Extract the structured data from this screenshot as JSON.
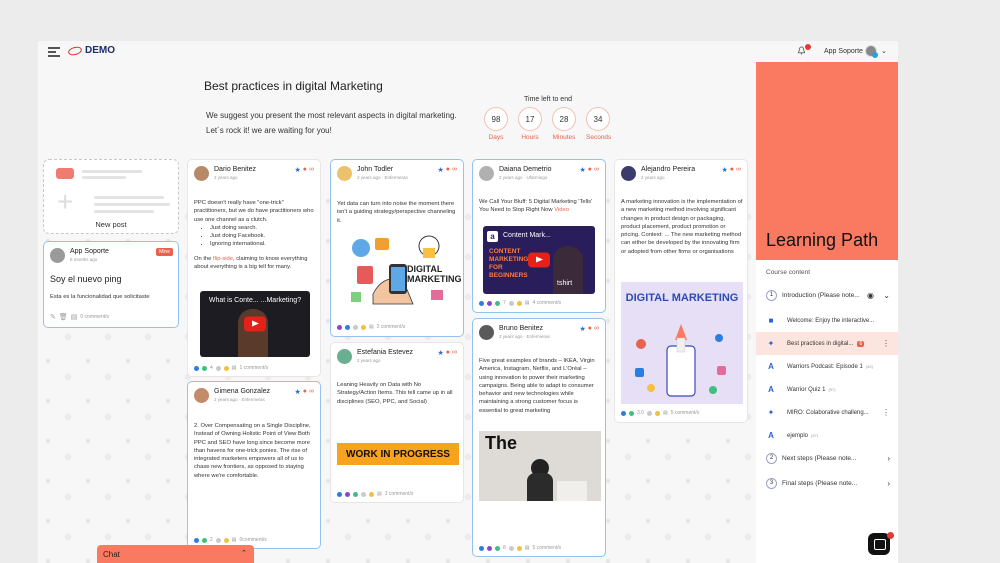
{
  "header": {
    "logo_text": "DEMO",
    "user_name": "App Soporte"
  },
  "challenge": {
    "title": "Best practices in digital Marketing",
    "desc_line1": "We suggest you present the most relevant aspects in digital marketing.",
    "desc_line2": "Let´s rock it! we are waiting for you!",
    "timer_label": "Time left to end",
    "timer": [
      {
        "value": "98",
        "unit": "Days"
      },
      {
        "value": "17",
        "unit": "Hours"
      },
      {
        "value": "28",
        "unit": "Minutes"
      },
      {
        "value": "34",
        "unit": "Seconds"
      }
    ]
  },
  "new_post_label": "New post",
  "posts": {
    "app_soporte": {
      "author": "App Soporte",
      "meta": "9 months ago",
      "badge": "Mine",
      "title": "Soy el nuevo ping",
      "body": "Esta es la funcionalidad que solicitaste",
      "comments": "0 comment/s"
    },
    "dario": {
      "author": "Dario Benitez",
      "meta": "2 years ago",
      "p1": "PPC doesn't really have \"one-trick\" practitioners, but we do have practitioners who use one channel as a clutch.",
      "bullets": [
        "Just doing search.",
        "Just doing Facebook.",
        "Ignoring international."
      ],
      "p2_pre": "On the ",
      "p2_link": "flip-side",
      "p2_post": ", claiming to know everything about everything is a big tell for many.",
      "video_title": "What is Conte... ...Marketing?",
      "count": "4",
      "comments": "1 comment/s"
    },
    "gimena": {
      "author": "Gimena Gonzalez",
      "meta": "2 years ago · Enfermeras",
      "body": "2. Over Compensating on a Single Discipline, Instead of Owning Holistic Point of View Both PPC and SEO have long since become more than havens for one-trick ponies. The rise of integrated marketers empowers all of us to chase new frontiers, as opposed to staying where we're comfortable.",
      "count": "2",
      "comments": "0comment/s"
    },
    "john": {
      "author": "John Todler",
      "meta": "2 years ago · Enfermeras",
      "body": "Yet data can turn into noise the moment there isn't a guiding strategy/perspective channeling it.",
      "image_text": "DIGITAL MARKETING",
      "comments": "2 comment/s"
    },
    "estefania": {
      "author": "Estefania Estevez",
      "meta": "2 years ago",
      "body": "Leaning Heavily on Data with No Strategy/Action Items. This tell came up in all disciplines (SEO, PPC, and Social)",
      "image_text": "WORK IN PROGRESS",
      "comments": "3 comment/s"
    },
    "daiana": {
      "author": "Daiana Demetrio",
      "meta": "2 years ago · Ufarmingo",
      "body_pre": "We Call Your Bluff: 5 Digital Marketing 'Tells' You Need to Stop Right Now ",
      "body_link": "Video",
      "video_top": "Content Mark...",
      "video_mid": "CONTENT MARKETING FOR BEGINNERS",
      "video_bottom": "tshirt",
      "count": "7",
      "comments": "4 comment/s"
    },
    "bruno": {
      "author": "Bruno Benitez",
      "meta": "2 years ago · Enfermeras",
      "body": "Five great examples of brands – IKEA, Virgin America, Instagram, Netflix, and L'Oréal – using innovation to power their marketing campaigns. Being able to adapt to consumer behavior and new technologies while maintaining a strong customer focus is essential to great marketing",
      "image_text": "The",
      "count": "8",
      "comments": "5 comment/s"
    },
    "alejandro": {
      "author": "Alejandro Pereira",
      "meta": "2 years ago",
      "body": "A marketing innovation is the implementation of a new marketing method involving significant changes in product design or packaging, product placement, product promotion or pricing. Context: ... The new marketing method can either be developed by the innovating firm or adopted from other firms or organisations",
      "image_text": "DIGITAL MARKETING",
      "count": "3.0",
      "comments": "5 comment/s"
    }
  },
  "learning_path": {
    "title": "Learning Path",
    "course_label": "Course content",
    "module1": {
      "num": "1",
      "label": "Introduction (Please note..."
    },
    "lessons": [
      {
        "label": "Welcome: Enjoy the interactive...",
        "sub": ""
      },
      {
        "label": "Best practices in digital...",
        "sub": "",
        "badge": "6"
      },
      {
        "label": "Warriors Podcast: Episode 1",
        "sub": "(40)"
      },
      {
        "label": "Warrior Quiz 1",
        "sub": "(97)"
      },
      {
        "label": "MIRO: Colaborative challeng...",
        "sub": ""
      },
      {
        "label": "ejemplo",
        "sub": "(97)"
      }
    ],
    "module2": {
      "num": "2",
      "label": "Next steps (Please note..."
    },
    "module3": {
      "num": "3",
      "label": "Final steps (Please note..."
    }
  },
  "chat_label": "Chat",
  "colors": {
    "accent": "#f97a61",
    "link": "#e8634d",
    "highlight": "#93c2f0",
    "brand": "#1d2c6b"
  }
}
